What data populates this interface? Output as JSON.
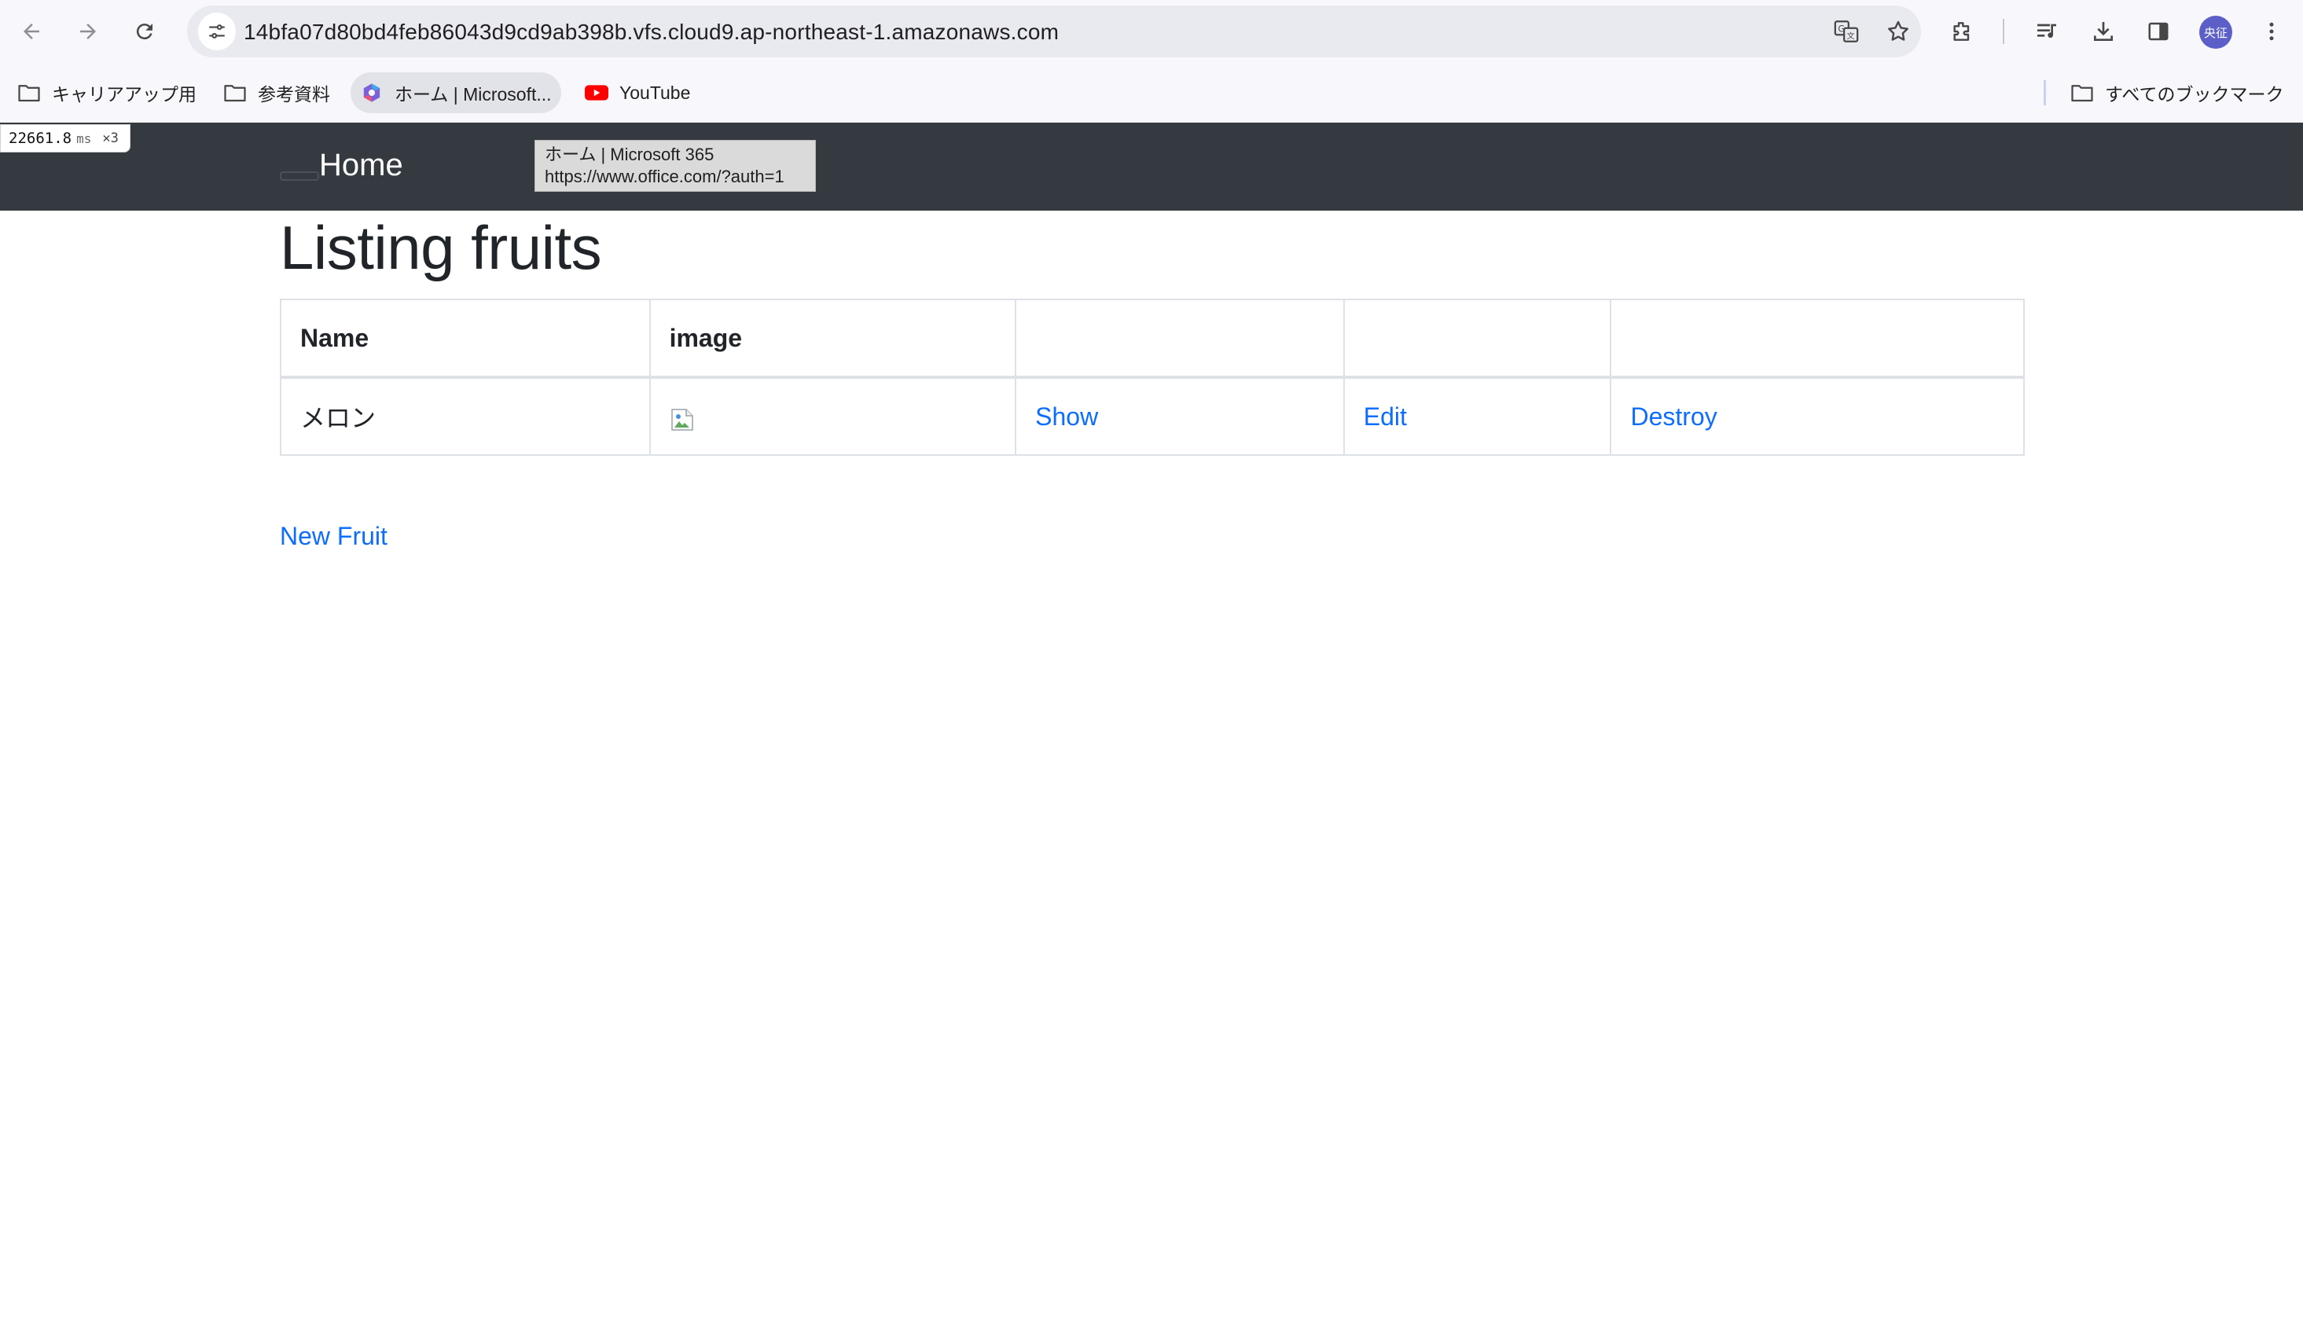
{
  "browser": {
    "url": "14bfa07d80bd4feb86043d9cd9ab398b.vfs.cloud9.ap-northeast-1.amazonaws.com",
    "avatar_text": "央征",
    "bookmarks": [
      {
        "label": "キャリアアップ用",
        "icon": "folder-icon"
      },
      {
        "label": "参考資料",
        "icon": "folder-icon"
      },
      {
        "label": "ホーム | Microsoft...",
        "icon": "microsoft365-icon"
      },
      {
        "label": "YouTube",
        "icon": "youtube-icon"
      }
    ],
    "all_bookmarks": "すべてのブックマーク",
    "tooltip": {
      "title": "ホーム | Microsoft 365",
      "url": "https://www.office.com/?auth=1"
    }
  },
  "perf": {
    "value": "22661.8",
    "unit": "ms",
    "count": "✕3"
  },
  "navbar": {
    "brand": "Home"
  },
  "page": {
    "title": "Listing fruits",
    "table": {
      "headers": [
        "Name",
        "image",
        "",
        "",
        ""
      ],
      "rows": [
        {
          "name": "メロン",
          "show": "Show",
          "edit": "Edit",
          "destroy": "Destroy"
        }
      ]
    },
    "new_link": "New Fruit"
  },
  "colors": {
    "navbar_bg": "#343a40",
    "link": "#0d6efd",
    "chrome_bg": "#f8f7fb"
  }
}
